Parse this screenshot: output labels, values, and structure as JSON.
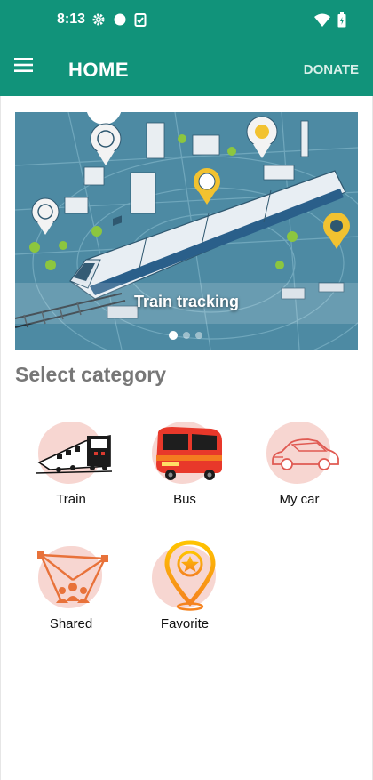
{
  "status_bar": {
    "time": "8:13",
    "left_icons": [
      "gear-icon",
      "circle-icon",
      "clipboard-check-icon"
    ],
    "right_icons": [
      "wifi-icon",
      "battery-icon"
    ]
  },
  "app_bar": {
    "menu_icon": "hamburger-menu-icon",
    "title": "HOME",
    "donate_label": "DONATE",
    "background_color": "#11937a"
  },
  "carousel": {
    "caption": "Train tracking",
    "slide_count": 3,
    "active_slide": 1
  },
  "section_title": "Select category",
  "categories": [
    {
      "label": "Train",
      "icon": "train-icon"
    },
    {
      "label": "Bus",
      "icon": "bus-icon"
    },
    {
      "label": "My car",
      "icon": "car-icon"
    },
    {
      "label": "Shared",
      "icon": "shared-ride-icon"
    },
    {
      "label": "Favorite",
      "icon": "favorite-pin-icon"
    }
  ]
}
